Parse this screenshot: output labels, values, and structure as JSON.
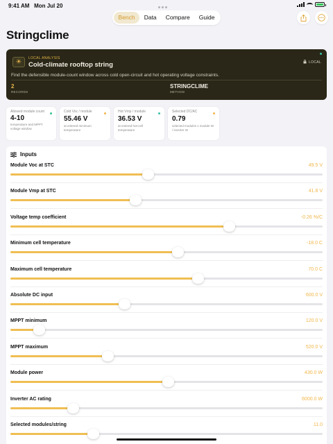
{
  "status": {
    "time": "9:41 AM",
    "date": "Mon Jul 20"
  },
  "tabs": [
    {
      "label": "Bench",
      "active": true
    },
    {
      "label": "Data",
      "active": false
    },
    {
      "label": "Compare",
      "active": false
    },
    {
      "label": "Guide",
      "active": false
    }
  ],
  "toolbar": {
    "share_icon": "share-icon",
    "more_icon": "ellipsis-icon"
  },
  "page": {
    "title": "Stringclime"
  },
  "hero": {
    "eyebrow": "LOCAL ANALYSIS",
    "title": "Cold-climate rooftop string",
    "badge": "LOCAL",
    "description": "Find the defensible module-count window across cold open-circuit and hot operating voltage constraints.",
    "stat1_value": "2",
    "stat1_label": "RECORDS",
    "stat2_value": "STRINGCLIME",
    "stat2_label": "METHOD"
  },
  "cards": [
    {
      "label": "Allowed module count",
      "value": "4-10",
      "note": "temperature and MPPT voltage window",
      "dot_color": "#35c28f"
    },
    {
      "label": "Cold Voc / module",
      "value": "55.46 V",
      "note": "at entered minimum temperature",
      "dot_color": "#f0b64a"
    },
    {
      "label": "Hot Vmp / module",
      "value": "36.53 V",
      "note": "at entered hot-cell temperature",
      "dot_color": "#35c2a8"
    },
    {
      "label": "Selected DC/AC",
      "value": "0.79",
      "note": "selected modules x module W / inverter W",
      "dot_color": "#f0b64a"
    }
  ],
  "inputs": {
    "heading": "Inputs",
    "items": [
      {
        "label": "Module Voc at STC",
        "value": "49.5 V",
        "level": 0.44
      },
      {
        "label": "Module Vmp at STC",
        "value": "41.8 V",
        "level": 0.4
      },
      {
        "label": "Voltage temp coefficient",
        "value": "-0.26 %/C",
        "level": 0.7
      },
      {
        "label": "Minimum cell temperature",
        "value": "-18.0 C",
        "level": 0.535
      },
      {
        "label": "Maximum cell temperature",
        "value": "70.0 C",
        "level": 0.6
      },
      {
        "label": "Absolute DC input",
        "value": "600.0 V",
        "level": 0.365
      },
      {
        "label": "MPPT minimum",
        "value": "120.0 V",
        "level": 0.09
      },
      {
        "label": "MPPT maximum",
        "value": "520.0 V",
        "level": 0.31
      },
      {
        "label": "Module power",
        "value": "430.0 W",
        "level": 0.505
      },
      {
        "label": "Inverter AC rating",
        "value": "6000.0 W",
        "level": 0.2
      },
      {
        "label": "Selected modules/string",
        "value": "11.0",
        "level": 0.265
      }
    ]
  }
}
